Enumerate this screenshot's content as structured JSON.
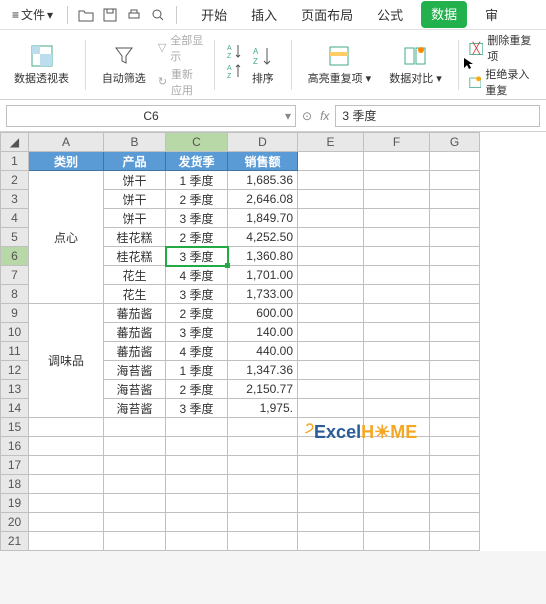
{
  "menubar": {
    "file_label": "文件",
    "tabs": [
      "开始",
      "插入",
      "页面布局",
      "公式",
      "数据",
      "审"
    ]
  },
  "ribbon": {
    "pivot": "数据透视表",
    "filter": "自动筛选",
    "show_all": "全部显示",
    "reapply": "重新应用",
    "sort": "排序",
    "highlight": "高亮重复项",
    "compare": "数据对比",
    "dedup": "删除重复项",
    "reject": "拒绝录入重复"
  },
  "fbar": {
    "cellref": "C6",
    "fx_value": "3 季度"
  },
  "columns": [
    "A",
    "B",
    "C",
    "D",
    "E",
    "F",
    "G"
  ],
  "headers": {
    "A": "类别",
    "B": "产品",
    "C": "发货季",
    "D": "销售额"
  },
  "merged": {
    "dianxin": "点心",
    "tiaowei": "调味品"
  },
  "chart_data": {
    "type": "table",
    "columns": [
      "类别",
      "产品",
      "发货季",
      "销售额"
    ],
    "rows": [
      {
        "cat": "点心",
        "prod": "饼干",
        "season": "1 季度",
        "amount": "1,685.36"
      },
      {
        "cat": "点心",
        "prod": "饼干",
        "season": "2 季度",
        "amount": "2,646.08"
      },
      {
        "cat": "点心",
        "prod": "饼干",
        "season": "3 季度",
        "amount": "1,849.70"
      },
      {
        "cat": "点心",
        "prod": "桂花糕",
        "season": "2 季度",
        "amount": "4,252.50"
      },
      {
        "cat": "点心",
        "prod": "桂花糕",
        "season": "3 季度",
        "amount": "1,360.80"
      },
      {
        "cat": "点心",
        "prod": "花生",
        "season": "4 季度",
        "amount": "1,701.00"
      },
      {
        "cat": "点心",
        "prod": "花生",
        "season": "3 季度",
        "amount": "1,733.00"
      },
      {
        "cat": "调味品",
        "prod": "蕃茄酱",
        "season": "2 季度",
        "amount": "600.00"
      },
      {
        "cat": "调味品",
        "prod": "蕃茄酱",
        "season": "3 季度",
        "amount": "140.00"
      },
      {
        "cat": "调味品",
        "prod": "蕃茄酱",
        "season": "4 季度",
        "amount": "440.00"
      },
      {
        "cat": "调味品",
        "prod": "海苔酱",
        "season": "1 季度",
        "amount": "1,347.36"
      },
      {
        "cat": "调味品",
        "prod": "海苔酱",
        "season": "2 季度",
        "amount": "2,150.77"
      },
      {
        "cat": "调味品",
        "prod": "海苔酱",
        "season": "3 季度",
        "amount": "1,975."
      }
    ]
  },
  "watermark": {
    "text1": "E",
    "text2": "xcel",
    "text3": "H",
    "text4": "ME"
  }
}
